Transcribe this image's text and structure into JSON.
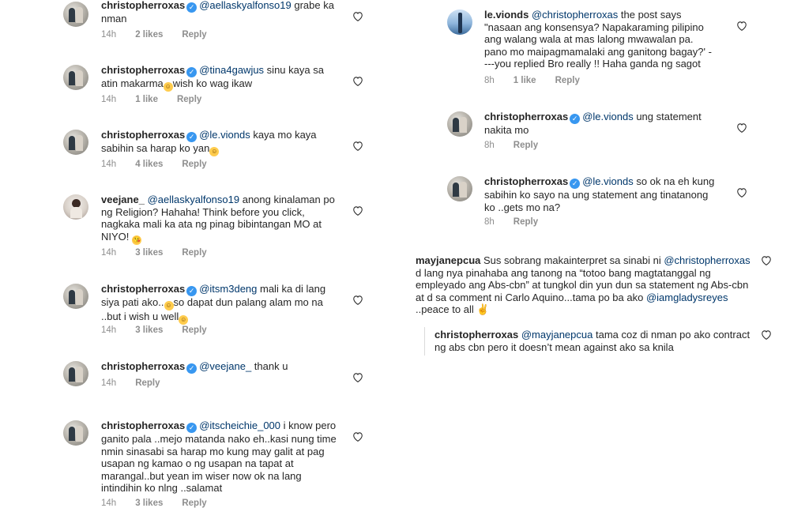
{
  "colors": {
    "text": "#262626",
    "meta": "#8e8e8e",
    "mention": "#00376b",
    "verified": "#3897f0"
  },
  "icons": {
    "like": "heart-outline-icon",
    "verified": "verified-badge-icon"
  },
  "left": [
    {
      "user": "christopherroxas",
      "mention": "@aellaskyalfonso19",
      "text": " grabe ka nman",
      "time": "14h",
      "likes": "2 likes",
      "reply": "Reply"
    },
    {
      "user": "christopherroxas",
      "mention": "@tina4gawjus",
      "text": " sinu kaya sa atin makarma",
      "text2": "wish ko wag ikaw",
      "time": "14h",
      "likes": "1 like",
      "reply": "Reply"
    },
    {
      "user": "christopherroxas",
      "mention": "@le.vionds",
      "text": " kaya mo kaya sabihin sa harap ko yan",
      "time": "14h",
      "likes": "4 likes",
      "reply": "Reply"
    },
    {
      "user": "veejane_",
      "mention": "@aellaskyalfonso19",
      "text": " anong kinalaman po ng Religion? Hahaha! Think before you click, nagkaka mali ka ata ng pinag bibintangan MO at NIYO! ",
      "time": "14h",
      "likes": "3 likes",
      "reply": "Reply"
    },
    {
      "user": "christopherroxas",
      "mention": "@itsm3deng",
      "text": " mali ka di lang siya pati ako..",
      "text2": "so dapat dun palang alam mo na ..but i wish u well",
      "time": "14h",
      "likes": "3 likes",
      "reply": "Reply"
    },
    {
      "user": "christopherroxas",
      "mention": "@veejane_",
      "text": " thank u",
      "time": "14h",
      "reply": "Reply"
    },
    {
      "user": "christopherroxas",
      "mention": "@itscheichie_000",
      "text": " i know pero ganito pala ..mejo matanda nako eh..kasi nung time nmin sinasabi sa harap mo kung may galit at pag usapan ng kamao o ng usapan na tapat at marangal..but yean im wiser now ok na lang intindihin ko nlng ..salamat",
      "time": "14h",
      "likes": "3 likes",
      "reply": "Reply"
    }
  ],
  "right": [
    {
      "user": "le.vionds",
      "mention": "@christopherroxas",
      "text": " the post says \"nasaan ang konsensya? Napakaraming pilipino ang walang wala at mas lalong mwawalan pa. pano mo maipagmamalaki ang ganitong bagay?' ----you replied Bro really !! Haha ganda ng sagot",
      "time": "8h",
      "likes": "1 like",
      "reply": "Reply"
    },
    {
      "user": "christopherroxas",
      "mention": "@le.vionds",
      "text": " ung statement nakita mo",
      "time": "8h",
      "reply": "Reply"
    },
    {
      "user": "christopherroxas",
      "mention": "@le.vionds",
      "text": " so ok na eh kung sabihin ko sayo na ung statement ang tinatanong ko ..gets mo na?",
      "time": "8h",
      "reply": "Reply"
    }
  ],
  "bottom": {
    "user": "mayjanepcua",
    "text": " Sus sobrang makainterpret sa sinabi ni ",
    "mention": "@christopherroxas",
    "text2": " d lang nya pinahaba ang tanong na “totoo bang magtatanggal ng empleyado ang Abs-cbn” at tungkol din yun dun sa statement ng Abs-cbn at d sa comment ni Carlo Aquino...tama po ba ako ",
    "mention2": "@iamgladysreyes",
    "text3": " ..peace to all ✌",
    "reply_user": "christopherroxas",
    "reply_mention": "@mayjanepcua",
    "reply_text": " tama coz di nman po ako contract ng abs cbn pero it doesn’t mean against ako sa knila"
  }
}
